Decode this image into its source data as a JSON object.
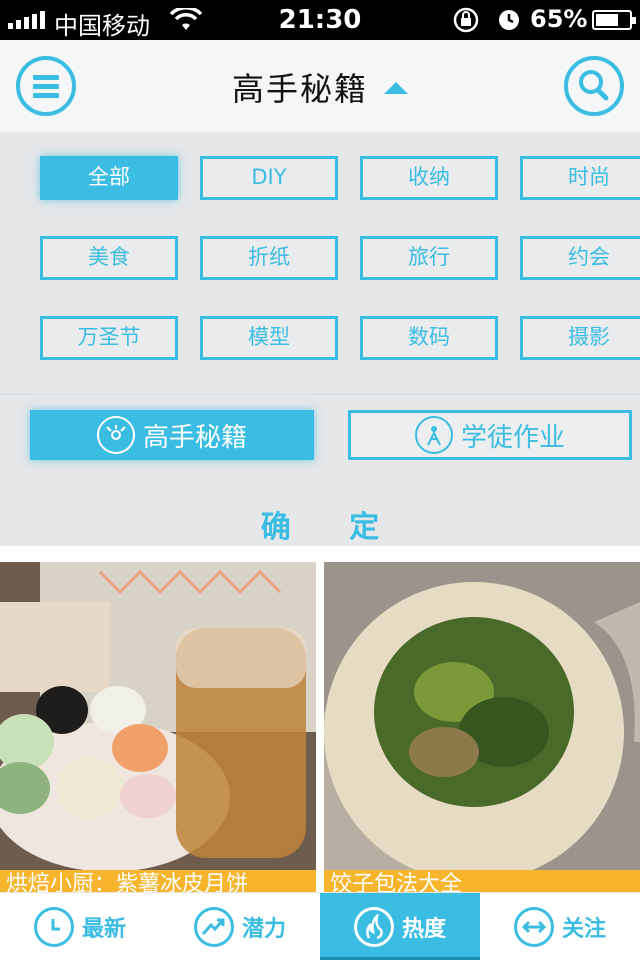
{
  "status": {
    "carrier": "中国移动",
    "time": "21:30",
    "battery": "65%"
  },
  "header": {
    "title": "高手秘籍"
  },
  "categories": [
    {
      "label": "全部",
      "active": true
    },
    {
      "label": "DIY"
    },
    {
      "label": "收纳"
    },
    {
      "label": "时尚"
    },
    {
      "label": "美食"
    },
    {
      "label": "折纸"
    },
    {
      "label": "旅行"
    },
    {
      "label": "约会"
    },
    {
      "label": "万圣节"
    },
    {
      "label": "模型"
    },
    {
      "label": "数码"
    },
    {
      "label": "摄影"
    }
  ],
  "modes": {
    "expert": "高手秘籍",
    "apprentice": "学徒作业"
  },
  "confirm": "确 定",
  "cards": [
    {
      "caption": "烘焙小厨：紫薯冰皮月饼"
    },
    {
      "caption": "饺子包法大全"
    }
  ],
  "tabs": [
    {
      "label": "最新"
    },
    {
      "label": "潜力"
    },
    {
      "label": "热度",
      "active": true
    },
    {
      "label": "关注"
    }
  ],
  "colors": {
    "accent": "#3bbde3",
    "caption_bar": "#f6b52c"
  }
}
